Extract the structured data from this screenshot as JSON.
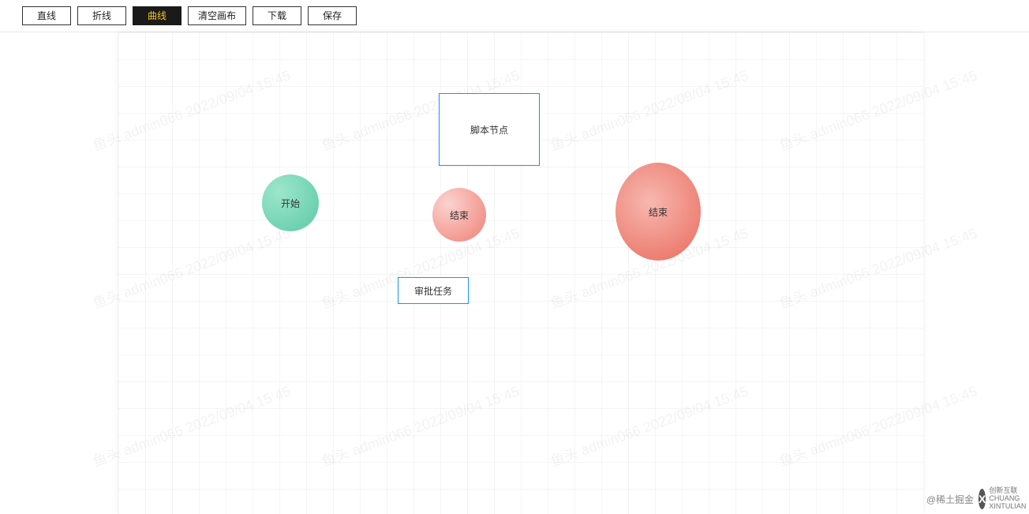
{
  "toolbar": {
    "line": "直线",
    "polyline": "折线",
    "curve": "曲线",
    "clear": "清空画布",
    "download": "下载",
    "save": "保存"
  },
  "nodes": {
    "script": "脚本节点",
    "start": "开始",
    "end1": "结束",
    "end2": "结束",
    "approval": "审批任务"
  },
  "watermark_text": "鱼头 admin066 2022/09/04 15:45",
  "credit": "@稀土掘金",
  "logo": {
    "mark": "X",
    "brand_line1": "创新互联",
    "brand_line2": "CHUANG XINTULIAN"
  }
}
